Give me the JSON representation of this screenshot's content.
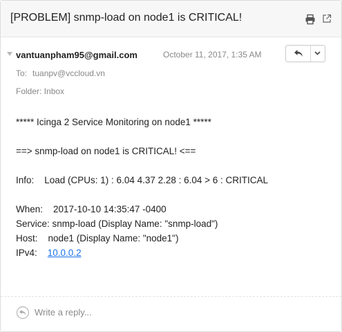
{
  "header": {
    "subject": "[PROBLEM] snmp-load on node1 is CRITICAL!",
    "icons": [
      "printer-icon",
      "pop-out-icon"
    ]
  },
  "message": {
    "sender": "vantuanpham95@gmail.com",
    "date": "October 11, 2017, 1:35 AM",
    "to_label": "To:",
    "to_value": "tuanpv@vccloud.vn",
    "folder_label": "Folder:",
    "folder_value": "Inbox",
    "reply_icon": "reply-arrow-icon",
    "more_icon": "chevron-down-icon"
  },
  "body": {
    "banner": "***** Icinga 2 Service Monitoring on node1 *****",
    "alert": "==> snmp-load on node1 is CRITICAL! <==",
    "info": "Info:    Load (CPUs: 1) : 6.04 4.37 2.28 : 6.04 > 6 : CRITICAL",
    "when": "When:    2017-10-10 14:35:47 -0400",
    "service": "Service: snmp-load (Display Name: \"snmp-load\")",
    "host": "Host:    node1 (Display Name: \"node1\")",
    "ipv4_label": "IPv4:    ",
    "ipv4_link": "10.0.0.2"
  },
  "reply": {
    "placeholder": "Write a reply..."
  },
  "colors": {
    "link": "#1a73e8",
    "muted": "#888888",
    "header_bg": "#f7f7f7"
  }
}
